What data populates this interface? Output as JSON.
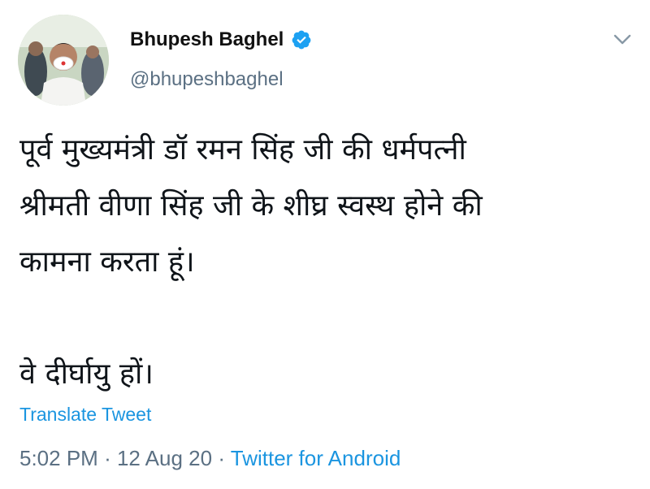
{
  "tweet": {
    "author": {
      "display_name": "Bhupesh Baghel",
      "handle": "@bhupeshbaghel",
      "verified": true
    },
    "text_lines": [
      "पूर्व मुख्यमंत्री डॉ रमन सिंह जी की धर्मपत्नी",
      "श्रीमती वीणा सिंह जी के शीघ्र स्वस्थ होने की",
      "कामना करता हूं।",
      "वे दीर्घायु हों।"
    ],
    "translate_label": "Translate Tweet",
    "time": "5:02 PM",
    "separator": "·",
    "date": "12 Aug 20",
    "source": "Twitter for Android"
  },
  "colors": {
    "link": "#1b95e0",
    "secondary_text": "#5b7083",
    "verified_badge": "#1da1f2"
  },
  "icons": {
    "verified": "verified-badge-icon",
    "menu": "chevron-down-icon"
  }
}
